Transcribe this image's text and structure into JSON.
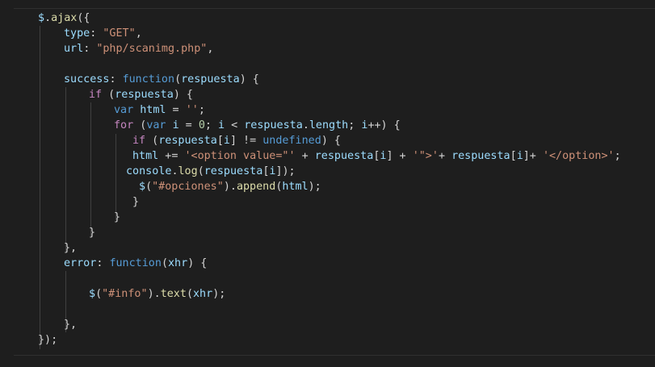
{
  "editor": {
    "theme_colors": {
      "background": "#1e1e1e",
      "default": "#d4d4d4",
      "keyword": "#569cd6",
      "function": "#dcdcaa",
      "variable": "#9cdcfe",
      "string": "#ce9178",
      "number": "#b5cea8",
      "control": "#c586c0"
    },
    "lines": [
      [
        {
          "t": "$",
          "c": "variable"
        },
        {
          "t": ".",
          "c": "default"
        },
        {
          "t": "ajax",
          "c": "function"
        },
        {
          "t": "({",
          "c": "default"
        }
      ],
      [
        {
          "t": "type",
          "c": "variable"
        },
        {
          "t": ": ",
          "c": "default"
        },
        {
          "t": "\"GET\"",
          "c": "string"
        },
        {
          "t": ",",
          "c": "default"
        }
      ],
      [
        {
          "t": "url",
          "c": "variable"
        },
        {
          "t": ": ",
          "c": "default"
        },
        {
          "t": "\"php/scanimg.php\"",
          "c": "string"
        },
        {
          "t": ",",
          "c": "default"
        }
      ],
      [],
      [
        {
          "t": "success",
          "c": "variable"
        },
        {
          "t": ": ",
          "c": "default"
        },
        {
          "t": "function",
          "c": "keyword"
        },
        {
          "t": "(",
          "c": "default"
        },
        {
          "t": "respuesta",
          "c": "variable"
        },
        {
          "t": ") {",
          "c": "default"
        }
      ],
      [
        {
          "t": "if",
          "c": "control"
        },
        {
          "t": " (",
          "c": "default"
        },
        {
          "t": "respuesta",
          "c": "variable"
        },
        {
          "t": ") {",
          "c": "default"
        }
      ],
      [
        {
          "t": "var",
          "c": "keyword"
        },
        {
          "t": " ",
          "c": "default"
        },
        {
          "t": "html",
          "c": "variable"
        },
        {
          "t": " = ",
          "c": "default"
        },
        {
          "t": "''",
          "c": "string"
        },
        {
          "t": ";",
          "c": "default"
        }
      ],
      [
        {
          "t": "for",
          "c": "control"
        },
        {
          "t": " (",
          "c": "default"
        },
        {
          "t": "var",
          "c": "keyword"
        },
        {
          "t": " ",
          "c": "default"
        },
        {
          "t": "i",
          "c": "variable"
        },
        {
          "t": " = ",
          "c": "default"
        },
        {
          "t": "0",
          "c": "number"
        },
        {
          "t": "; ",
          "c": "default"
        },
        {
          "t": "i",
          "c": "variable"
        },
        {
          "t": " < ",
          "c": "default"
        },
        {
          "t": "respuesta",
          "c": "variable"
        },
        {
          "t": ".",
          "c": "default"
        },
        {
          "t": "length",
          "c": "variable"
        },
        {
          "t": "; ",
          "c": "default"
        },
        {
          "t": "i",
          "c": "variable"
        },
        {
          "t": "++) {",
          "c": "default"
        }
      ],
      [
        {
          "t": "if",
          "c": "control"
        },
        {
          "t": " (",
          "c": "default"
        },
        {
          "t": "respuesta",
          "c": "variable"
        },
        {
          "t": "[",
          "c": "default"
        },
        {
          "t": "i",
          "c": "variable"
        },
        {
          "t": "] != ",
          "c": "default"
        },
        {
          "t": "undefined",
          "c": "keyword"
        },
        {
          "t": ") {",
          "c": "default"
        }
      ],
      [
        {
          "t": "html",
          "c": "variable"
        },
        {
          "t": " += ",
          "c": "default"
        },
        {
          "t": "'<option value=\"'",
          "c": "string"
        },
        {
          "t": " + ",
          "c": "default"
        },
        {
          "t": "respuesta",
          "c": "variable"
        },
        {
          "t": "[",
          "c": "default"
        },
        {
          "t": "i",
          "c": "variable"
        },
        {
          "t": "] + ",
          "c": "default"
        },
        {
          "t": "'\">'",
          "c": "string"
        },
        {
          "t": "+ ",
          "c": "default"
        },
        {
          "t": "respuesta",
          "c": "variable"
        },
        {
          "t": "[",
          "c": "default"
        },
        {
          "t": "i",
          "c": "variable"
        },
        {
          "t": "]+ ",
          "c": "default"
        },
        {
          "t": "'</option>'",
          "c": "string"
        },
        {
          "t": ";",
          "c": "default"
        }
      ],
      [
        {
          "t": "console",
          "c": "variable"
        },
        {
          "t": ".",
          "c": "default"
        },
        {
          "t": "log",
          "c": "function"
        },
        {
          "t": "(",
          "c": "default"
        },
        {
          "t": "respuesta",
          "c": "variable"
        },
        {
          "t": "[",
          "c": "default"
        },
        {
          "t": "i",
          "c": "variable"
        },
        {
          "t": "]);",
          "c": "default"
        }
      ],
      [
        {
          "t": "$",
          "c": "variable"
        },
        {
          "t": "(",
          "c": "default"
        },
        {
          "t": "\"#opciones\"",
          "c": "string"
        },
        {
          "t": ").",
          "c": "default"
        },
        {
          "t": "append",
          "c": "function"
        },
        {
          "t": "(",
          "c": "default"
        },
        {
          "t": "html",
          "c": "variable"
        },
        {
          "t": ");",
          "c": "default"
        }
      ],
      [
        {
          "t": "}",
          "c": "default"
        }
      ],
      [
        {
          "t": "}",
          "c": "default"
        }
      ],
      [
        {
          "t": "}",
          "c": "default"
        }
      ],
      [
        {
          "t": "},",
          "c": "default"
        }
      ],
      [
        {
          "t": "error",
          "c": "variable"
        },
        {
          "t": ": ",
          "c": "default"
        },
        {
          "t": "function",
          "c": "keyword"
        },
        {
          "t": "(",
          "c": "default"
        },
        {
          "t": "xhr",
          "c": "variable"
        },
        {
          "t": ") {",
          "c": "default"
        }
      ],
      [],
      [
        {
          "t": "$",
          "c": "variable"
        },
        {
          "t": "(",
          "c": "default"
        },
        {
          "t": "\"#info\"",
          "c": "string"
        },
        {
          "t": ").",
          "c": "default"
        },
        {
          "t": "text",
          "c": "function"
        },
        {
          "t": "(",
          "c": "default"
        },
        {
          "t": "xhr",
          "c": "variable"
        },
        {
          "t": ");",
          "c": "default"
        }
      ],
      [],
      [
        {
          "t": "},",
          "c": "default"
        }
      ],
      [
        {
          "t": "});",
          "c": "default"
        }
      ]
    ]
  }
}
